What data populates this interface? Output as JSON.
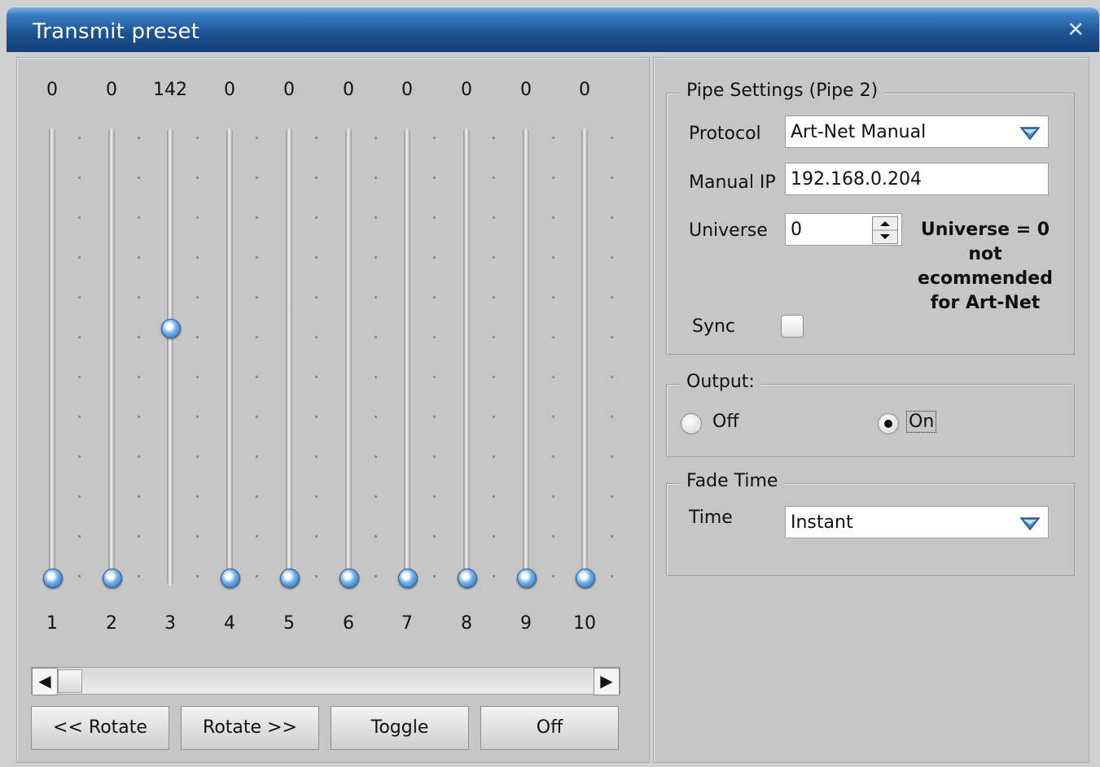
{
  "window": {
    "title": "Transmit preset",
    "close_icon": "close-icon"
  },
  "channels": [
    {
      "number": "1",
      "value": "0"
    },
    {
      "number": "2",
      "value": "0"
    },
    {
      "number": "3",
      "value": "142"
    },
    {
      "number": "4",
      "value": "0"
    },
    {
      "number": "5",
      "value": "0"
    },
    {
      "number": "6",
      "value": "0"
    },
    {
      "number": "7",
      "value": "0"
    },
    {
      "number": "8",
      "value": "0"
    },
    {
      "number": "9",
      "value": "0"
    },
    {
      "number": "10",
      "value": "0"
    }
  ],
  "buttons": {
    "rotate_left": "<< Rotate",
    "rotate_right": "Rotate >>",
    "toggle": "Toggle",
    "off": "Off"
  },
  "pipe": {
    "legend": "Pipe Settings (Pipe 2)",
    "protocol_label": "Protocol",
    "protocol_value": "Art-Net Manual",
    "ip_label": "Manual IP",
    "ip_value": "192.168.0.204",
    "universe_label": "Universe",
    "universe_value": "0",
    "warning_lines": [
      "Universe = 0",
      "not",
      "ecommended",
      "for Art-Net"
    ],
    "sync_label": "Sync"
  },
  "output": {
    "legend": "Output:",
    "off_label": "Off",
    "on_label": "On",
    "selected": "On"
  },
  "fade": {
    "legend": "Fade Time",
    "time_label": "Time",
    "time_value": "Instant"
  },
  "colors": {
    "title_bar": "#1e5597",
    "knob": "#4f95db",
    "panel": "#c6c6c6"
  }
}
